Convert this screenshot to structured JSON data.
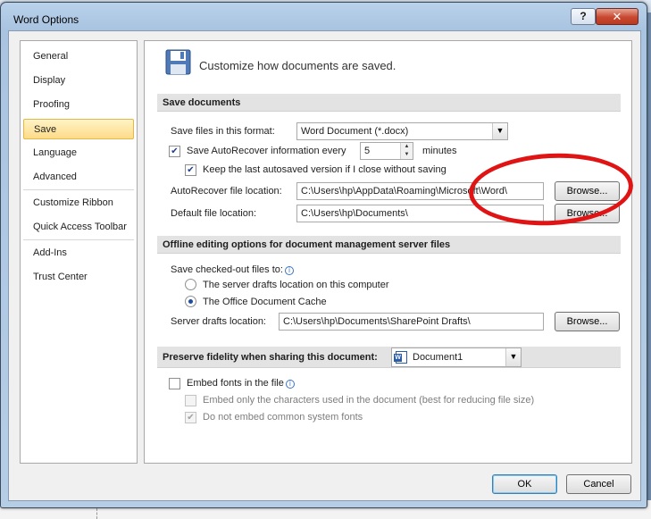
{
  "window": {
    "title": "Word Options",
    "help_label": "?",
    "close_label": "✕"
  },
  "nav": {
    "items": [
      {
        "label": "General"
      },
      {
        "label": "Display"
      },
      {
        "label": "Proofing"
      },
      {
        "label": "Save",
        "selected": true
      },
      {
        "label": "Language"
      },
      {
        "label": "Advanced"
      },
      {
        "label": "Customize Ribbon"
      },
      {
        "label": "Quick Access Toolbar"
      },
      {
        "label": "Add-Ins"
      },
      {
        "label": "Trust Center"
      }
    ]
  },
  "header": {
    "icon": "floppy-disk-icon",
    "text": "Customize how documents are saved."
  },
  "save_documents": {
    "section_title": "Save documents",
    "format_label": "Save files in this format:",
    "format_value": "Word Document (*.docx)",
    "autorecover_label": "Save AutoRecover information every",
    "autorecover_checked": true,
    "autorecover_minutes": "5",
    "minutes_label": "minutes",
    "keep_last_label": "Keep the last autosaved version if I close without saving",
    "keep_last_checked": true,
    "autorecover_location_label": "AutoRecover file location:",
    "autorecover_location_value": "C:\\Users\\hp\\AppData\\Roaming\\Microsoft\\Word\\",
    "default_location_label": "Default file location:",
    "default_location_value": "C:\\Users\\hp\\Documents\\",
    "browse_label": "Browse..."
  },
  "offline": {
    "section_title": "Offline editing options for document management server files",
    "checkout_label": "Save checked-out files to:",
    "option_server": "The server drafts location on this computer",
    "option_cache": "The Office Document Cache",
    "selected_option": "cache",
    "server_drafts_label": "Server drafts location:",
    "server_drafts_value": "C:\\Users\\hp\\Documents\\SharePoint Drafts\\",
    "browse_label": "Browse..."
  },
  "fidelity": {
    "section_title": "Preserve fidelity when sharing this document:",
    "document_value": "Document1",
    "embed_fonts_label": "Embed fonts in the file",
    "embed_fonts_checked": false,
    "embed_only_used_label": "Embed only the characters used in the document (best for reducing file size)",
    "embed_only_used_checked": false,
    "no_common_fonts_label": "Do not embed common system fonts",
    "no_common_fonts_checked": true
  },
  "footer": {
    "ok_label": "OK",
    "cancel_label": "Cancel"
  },
  "colors": {
    "annotation": "#e01414",
    "selected_nav": "#fddb8a"
  }
}
